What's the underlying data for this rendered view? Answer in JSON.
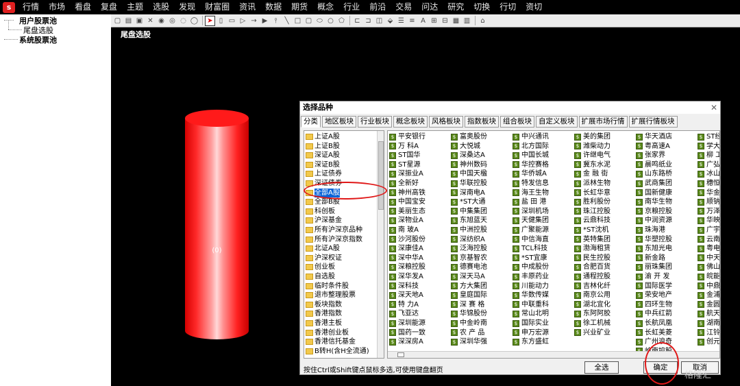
{
  "app": {
    "logo_char": "s"
  },
  "menu": [
    "行情",
    "市场",
    "看盘",
    "复盘",
    "主题",
    "选股",
    "发现",
    "财富圈",
    "资讯",
    "数据",
    "期货",
    "概念",
    "行业",
    "前沿",
    "交易",
    "问达",
    "研究",
    "切换",
    "行切",
    "资切"
  ],
  "sidebar": {
    "tree": [
      {
        "label": "用户股票池",
        "bold": true
      },
      {
        "label": "尾盘选股",
        "bold": false
      },
      {
        "label": "系统股票池",
        "bold": true
      }
    ]
  },
  "canvas": {
    "title": "尾盘选股",
    "bar_label": "(0)",
    "bar_value": 0
  },
  "dialog": {
    "title": "选择品种",
    "close_icon": "✕",
    "tabs": [
      "分类",
      "地区板块",
      "行业板块",
      "概念板块",
      "风格板块",
      "指数板块",
      "组合板块",
      "自定义板块",
      "扩展市场行情",
      "扩展行情板块"
    ],
    "categories": [
      "上证A股",
      "上证B股",
      "深证A股",
      "深证B股",
      "上证债券",
      "深证债券",
      "全部A股",
      "全部B股",
      "科创板",
      "沪深基金",
      "所有沪深京品种",
      "所有沪深京指数",
      "北证A股",
      "沪深权证",
      "创业板",
      "自选股",
      "临时条件股",
      "退市整理股票",
      "板块指数",
      "香港指数",
      "香港主板",
      "香港创业板",
      "香港信托基金",
      "B转H(含H全流通)"
    ],
    "selected_category": "全部A股",
    "stock_columns": [
      [
        "平安银行",
        "万 科A",
        "ST国华",
        "ST星源",
        "深振业A",
        "全新好",
        "神州高铁",
        "中国宝安",
        "美丽生态",
        "深物业A",
        "南 玻A",
        "沙河股份",
        "深康佳A",
        "深中华A",
        "深粮控股",
        "深华发A",
        "深科技",
        "深天地A",
        "特 力A",
        "飞亚达",
        "深圳能源",
        "国药一致",
        "深深房A"
      ],
      [
        "富奥股份",
        "大悦城",
        "深桑达A",
        "神州数码",
        "中国天楹",
        "华联控股",
        "深南电A",
        "*ST大通",
        "中集集团",
        "东旭蓝天",
        "中洲控股",
        "深纺织A",
        "泛海控股",
        "京基智农",
        "德赛电池",
        "深天马A",
        "方大集团",
        "皇庭国际",
        "深 赛 格",
        "华锦股份",
        "中金岭南",
        "农 产 品",
        "深圳华强"
      ],
      [
        "中兴通讯",
        "北方国际",
        "中国长城",
        "华控赛格",
        "华侨城A",
        "特发信息",
        "海王生物",
        "盐 田 港",
        "深圳机场",
        "天健集团",
        "广聚能源",
        "中信海直",
        "TCL科技",
        "*ST宜康",
        "中成股份",
        "丰原药业",
        "川能动力",
        "华数传媒",
        "中联重科",
        "常山北明",
        "国际实业",
        "申万宏源",
        "东方盛虹"
      ],
      [
        "美的集团",
        "潍柴动力",
        "许继电气",
        "冀东水泥",
        "金 融 街",
        "派林生物",
        "长虹华意",
        "胜利股份",
        "珠江控股",
        "云鼎科技",
        "*ST沈机",
        "英特集团",
        "渤海租赁",
        "民生控股",
        "合肥百货",
        "通程控股",
        "吉林化纤",
        "南京公用",
        "湖北宜化",
        "东阿阿胶",
        "徐工机械",
        "兴业矿业"
      ],
      [
        "华天酒店",
        "粤高速A",
        "张家界",
        "晨鸣纸业",
        "山东路桥",
        "武商集团",
        "国新健康",
        "南华生物",
        "京粮控股",
        "中润资源",
        "珠海港",
        "华塑控股",
        "东旭光电",
        "新金路",
        "丽珠集团",
        "渝 开 发",
        "国际医学",
        "荣安地产",
        "四环生物",
        "中兵红箭",
        "长航凤凰",
        "长虹美菱",
        "广州浪奇",
        "岭南控股"
      ],
      [
        "ST经纬",
        "学大教育",
        "柳 工",
        "广弘控股",
        "冰山冷热",
        "穗恒运A",
        "华金资本",
        "顺钠股份",
        "万泽股份",
        "华映科技",
        "广宇集团",
        "云南铜业",
        "粤电力A",
        "中天金融",
        "佛山照明",
        "皖能电力",
        "中鼎股份",
        "金浦钛业",
        "金圆股份",
        "航天科技",
        "湖南天雁",
        "江铃汽车",
        "创元科技"
      ]
    ],
    "hint": "按住Ctrl或Shift键点鼠标多选,可使用键盘翻页",
    "buttons": {
      "select_all": "全选",
      "ok": "确定",
      "cancel": "取消"
    }
  },
  "watermark": "格隆汇"
}
